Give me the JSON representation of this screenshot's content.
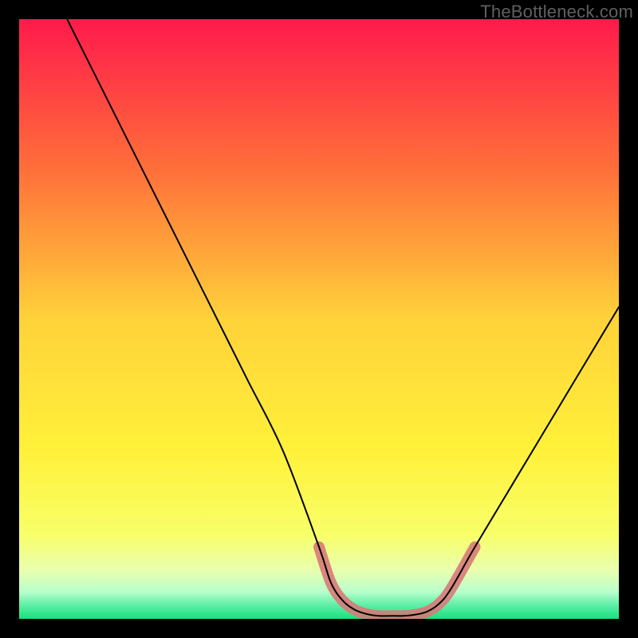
{
  "watermark": "TheBottleneck.com",
  "chart_data": {
    "type": "line",
    "title": "",
    "xlabel": "",
    "ylabel": "",
    "xlim": [
      0,
      100
    ],
    "ylim": [
      0,
      100
    ],
    "grid": false,
    "legend": null,
    "gradient_stops": [
      {
        "offset": 0,
        "color": "#ff1a4b"
      },
      {
        "offset": 0.25,
        "color": "#ff6f3a"
      },
      {
        "offset": 0.5,
        "color": "#ffd23a"
      },
      {
        "offset": 0.72,
        "color": "#fff13a"
      },
      {
        "offset": 0.86,
        "color": "#f8ff6a"
      },
      {
        "offset": 0.92,
        "color": "#e8ffb0"
      },
      {
        "offset": 0.955,
        "color": "#b8ffcc"
      },
      {
        "offset": 0.975,
        "color": "#66f0aa"
      },
      {
        "offset": 1.0,
        "color": "#18e080"
      }
    ],
    "series": [
      {
        "name": "bottleneck-curve",
        "x": [
          8,
          14,
          20,
          26,
          32,
          38,
          44,
          50,
          52,
          54,
          56,
          58,
          60,
          62,
          64,
          66,
          68,
          70,
          72,
          76,
          82,
          88,
          94,
          100
        ],
        "y": [
          100,
          88,
          76,
          64,
          52,
          40,
          28,
          12,
          6,
          3,
          1.5,
          0.8,
          0.5,
          0.5,
          0.5,
          0.7,
          1.2,
          2.5,
          5,
          12,
          22,
          32,
          42,
          52
        ],
        "stroke": "#000000",
        "stroke_width": 2
      }
    ],
    "threshold_band": {
      "name": "worst-zone-highlight",
      "color": "#d87a78",
      "opacity": 0.9,
      "width": 14,
      "x_start": 52,
      "x_end": 72
    }
  }
}
